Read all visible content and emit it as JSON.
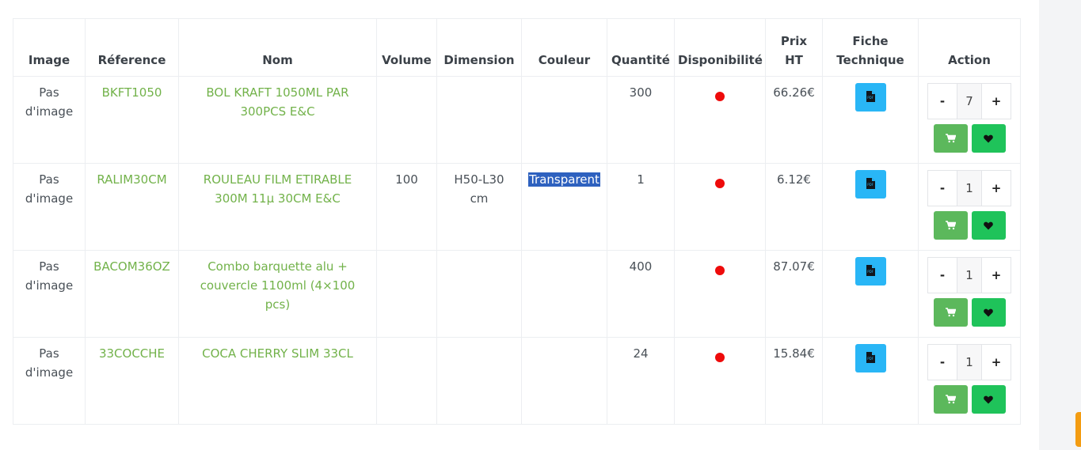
{
  "headers": {
    "image": "Image",
    "reference": "Réference",
    "nom": "Nom",
    "volume": "Volume",
    "dimension": "Dimension",
    "couleur": "Couleur",
    "quantite": "Quantité",
    "disponibilite": "Disponibilité",
    "prix_line1": "Prix",
    "prix_line2": "HT",
    "fiche_line1": "Fiche",
    "fiche_line2": "Technique",
    "action": "Action"
  },
  "rows": [
    {
      "image_line1": "Pas",
      "image_line2": "d'image",
      "reference": "BKFT1050",
      "nom": "BOL KRAFT 1050ML PAR 300PCS E&C",
      "volume": "",
      "dimension": "",
      "couleur": "",
      "quantite": "300",
      "prix": "66.26€",
      "qty_value": "7",
      "availability_color": "#ee0b0b"
    },
    {
      "image_line1": "Pas",
      "image_line2": "d'image",
      "reference": "RALIM30CM",
      "nom": "ROULEAU FILM ETIRABLE 300M 11µ 30CM E&C",
      "volume": "100",
      "dimension": "H50-L30 cm",
      "couleur": "Transparent",
      "quantite": "1",
      "prix": "6.12€",
      "qty_value": "1",
      "availability_color": "#ee0b0b"
    },
    {
      "image_line1": "Pas",
      "image_line2": "d'image",
      "reference": "BACOM36OZ",
      "nom": "Combo barquette alu + couvercle 1100ml (4×100 pcs)",
      "volume": "",
      "dimension": "",
      "couleur": "",
      "quantite": "400",
      "prix": "87.07€",
      "qty_value": "1",
      "availability_color": "#ee0b0b"
    },
    {
      "image_line1": "Pas",
      "image_line2": "d'image",
      "reference": "33COCCHE",
      "nom": "COCA CHERRY SLIM 33CL",
      "volume": "",
      "dimension": "",
      "couleur": "",
      "quantite": "24",
      "prix": "15.84€",
      "qty_value": "1",
      "availability_color": "#ee0b0b"
    }
  ],
  "buttons": {
    "minus": "-",
    "plus": "+"
  },
  "icons": {
    "pdf": "pdf-file-icon",
    "cart": "cart-icon",
    "favorite": "heart-icon"
  },
  "colors": {
    "link": "#72b24a",
    "pdf_button": "#29b6f6",
    "cart_button": "#5cb85c",
    "favorite_button": "#1fc35a",
    "selection": "#2e61bf",
    "unavailable": "#ee0b0b"
  }
}
